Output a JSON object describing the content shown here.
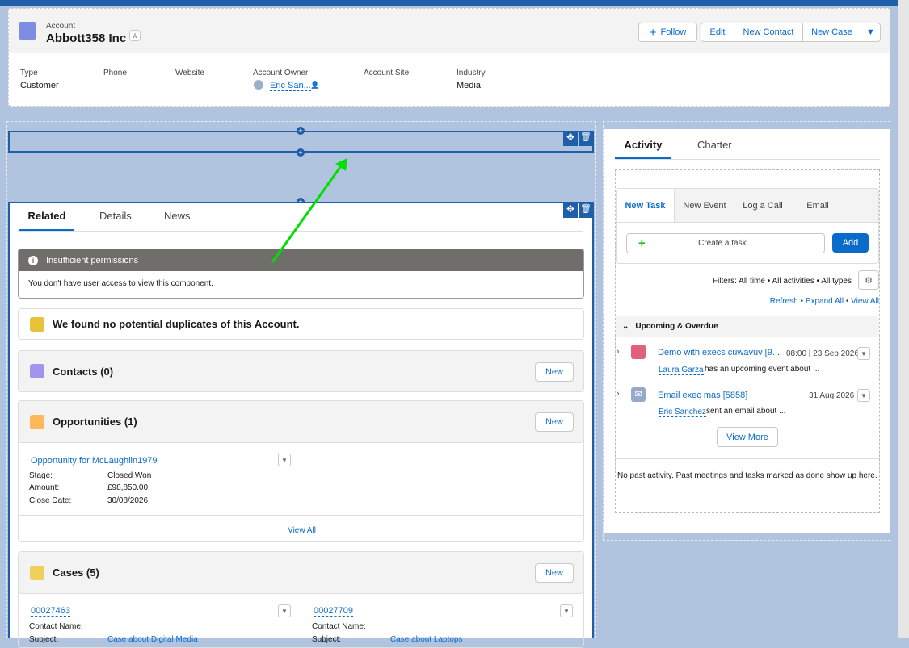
{
  "header": {
    "object_label": "Account",
    "title": "Abbott358 Inc",
    "actions": {
      "follow": "Follow",
      "edit": "Edit",
      "new_contact": "New Contact",
      "new_case": "New Case"
    },
    "fields": [
      {
        "label": "Type",
        "value": "Customer"
      },
      {
        "label": "Phone",
        "value": ""
      },
      {
        "label": "Website",
        "value": ""
      },
      {
        "label": "Account Owner",
        "value": "Eric San..."
      },
      {
        "label": "Account Site",
        "value": ""
      },
      {
        "label": "Industry",
        "value": "Media"
      }
    ]
  },
  "tabs": {
    "related": "Related",
    "details": "Details",
    "news": "News"
  },
  "permissions": {
    "title": "Insufficient permissions",
    "message": "You don't have user access to view this component."
  },
  "duplicates": "We found no potential duplicates of this Account.",
  "contacts": {
    "title": "Contacts (0)",
    "new": "New"
  },
  "opportunities": {
    "title": "Opportunities (1)",
    "new": "New",
    "item": {
      "name": "Opportunity for McLaughlin1979",
      "stage_label": "Stage:",
      "stage": "Closed Won",
      "amount_label": "Amount:",
      "amount": "£98,850.00",
      "close_label": "Close Date:",
      "close": "30/08/2026"
    },
    "view_all": "View All"
  },
  "cases": {
    "title": "Cases (5)",
    "new": "New",
    "items": [
      {
        "number": "00027463",
        "contact_label": "Contact Name:",
        "subject_label": "Subject:",
        "subject": "Case about Digital Media"
      },
      {
        "number": "00027709",
        "contact_label": "Contact Name:",
        "subject_label": "Subject:",
        "subject": "Case about Laptops"
      }
    ]
  },
  "activity": {
    "tabs": {
      "activity": "Activity",
      "chatter": "Chatter"
    },
    "subtabs": {
      "task": "New Task",
      "event": "New Event",
      "call": "Log a Call",
      "email": "Email"
    },
    "task_placeholder": "Create a task...",
    "add": "Add",
    "filters": "Filters: All time • All activities • All types",
    "refresh": "Refresh",
    "expand": "Expand All",
    "view_all": "View All",
    "sep": "•",
    "upcoming": "Upcoming & Overdue",
    "items": [
      {
        "title": "Demo with execs cuwavuv [9...",
        "date": "08:00 | 23 Sep 2026",
        "who": "Laura Garza",
        "desc": "has an upcoming event about ..."
      },
      {
        "title": "Email exec mas [5858]",
        "date": "31 Aug 2026",
        "who": "Eric Sanchez",
        "desc": "sent an email about ..."
      }
    ],
    "view_more": "View More",
    "no_past": "No past activity. Past meetings and tasks marked as done show up here."
  },
  "colors": {
    "brand": "#0b6bcb",
    "arrow": "#00e000"
  }
}
